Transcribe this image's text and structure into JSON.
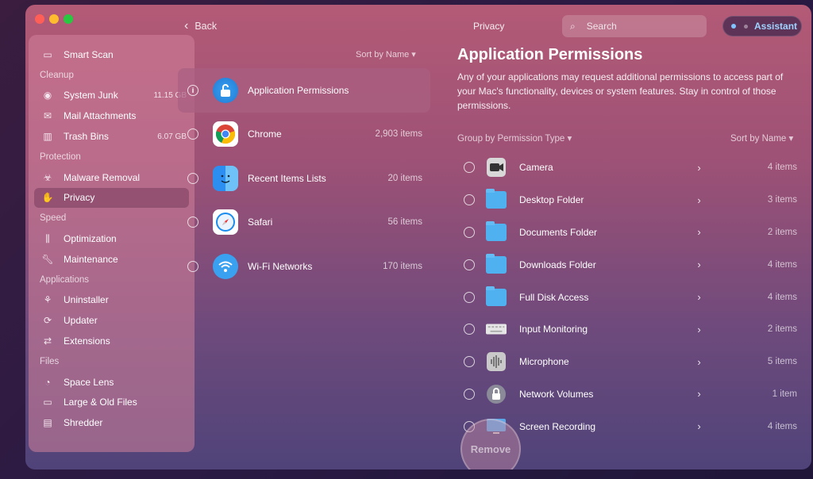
{
  "topbar": {
    "back_label": "Back",
    "title": "Privacy",
    "search_placeholder": "Search",
    "assistant_label": "Assistant"
  },
  "sidebar": {
    "smart_scan": "Smart Scan",
    "sections": {
      "cleanup": "Cleanup",
      "protection": "Protection",
      "speed": "Speed",
      "applications": "Applications",
      "files": "Files"
    },
    "items": {
      "system_junk": {
        "label": "System Junk",
        "size": "11.15 GB"
      },
      "mail_attachments": {
        "label": "Mail Attachments"
      },
      "trash_bins": {
        "label": "Trash Bins",
        "size": "6.07 GB"
      },
      "malware_removal": {
        "label": "Malware Removal"
      },
      "privacy": {
        "label": "Privacy"
      },
      "optimization": {
        "label": "Optimization"
      },
      "maintenance": {
        "label": "Maintenance"
      },
      "uninstaller": {
        "label": "Uninstaller"
      },
      "updater": {
        "label": "Updater"
      },
      "extensions": {
        "label": "Extensions"
      },
      "space_lens": {
        "label": "Space Lens"
      },
      "large_old_files": {
        "label": "Large & Old Files"
      },
      "shredder": {
        "label": "Shredder"
      }
    }
  },
  "middle": {
    "sort_label": "Sort by Name ▾",
    "rows": [
      {
        "name": "Application Permissions",
        "count": ""
      },
      {
        "name": "Chrome",
        "count": "2,903 items"
      },
      {
        "name": "Recent Items Lists",
        "count": "20 items"
      },
      {
        "name": "Safari",
        "count": "56 items"
      },
      {
        "name": "Wi-Fi Networks",
        "count": "170 items"
      }
    ]
  },
  "right": {
    "title": "Application Permissions",
    "description": "Any of your applications may request additional permissions to access part of your Mac's functionality, devices or system features. Stay in control of those permissions.",
    "group_by": "Group by Permission Type ▾",
    "sort_label": "Sort by Name ▾",
    "permissions": [
      {
        "name": "Camera",
        "count": "4 items",
        "icon": "camera-icon"
      },
      {
        "name": "Desktop Folder",
        "count": "3 items",
        "icon": "folder-icon"
      },
      {
        "name": "Documents Folder",
        "count": "2 items",
        "icon": "folder-icon"
      },
      {
        "name": "Downloads Folder",
        "count": "4 items",
        "icon": "folder-icon"
      },
      {
        "name": "Full Disk Access",
        "count": "4 items",
        "icon": "folder-icon"
      },
      {
        "name": "Input Monitoring",
        "count": "2 items",
        "icon": "keyboard-icon"
      },
      {
        "name": "Microphone",
        "count": "5 items",
        "icon": "microphone-icon"
      },
      {
        "name": "Network Volumes",
        "count": "1 item",
        "icon": "lock-icon"
      },
      {
        "name": "Screen Recording",
        "count": "4 items",
        "icon": "screen-icon"
      }
    ]
  },
  "actions": {
    "remove_label": "Remove"
  }
}
